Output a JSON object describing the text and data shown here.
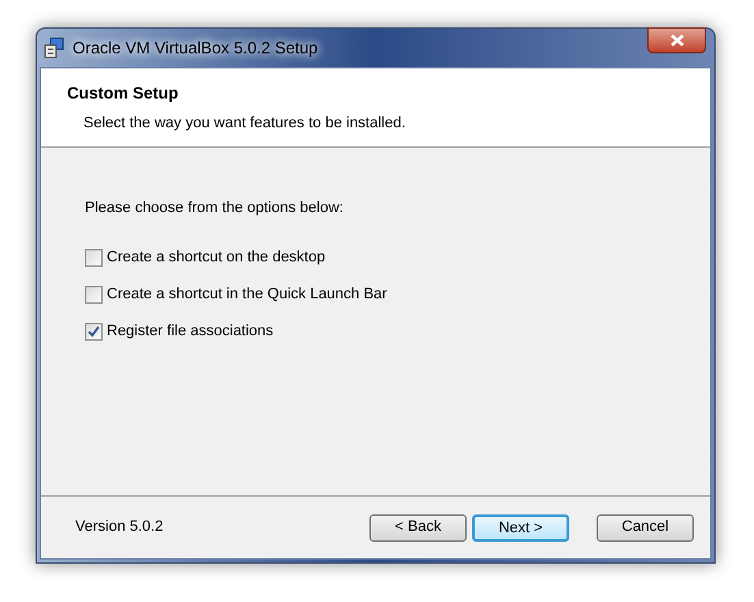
{
  "window": {
    "title": "Oracle VM VirtualBox 5.0.2 Setup"
  },
  "header": {
    "title": "Custom Setup",
    "subtitle": "Select the way you want features to be installed."
  },
  "prompt": "Please choose from the options below:",
  "options": [
    {
      "label": "Create a shortcut on the desktop",
      "checked": false
    },
    {
      "label": "Create a shortcut in the Quick Launch Bar",
      "checked": false
    },
    {
      "label": "Register file associations",
      "checked": true
    }
  ],
  "footer": {
    "version": "Version 5.0.2"
  },
  "buttons": [
    {
      "label": "< Back",
      "default": false
    },
    {
      "label": "Next >",
      "default": true
    },
    {
      "label": "Cancel",
      "default": false
    }
  ]
}
